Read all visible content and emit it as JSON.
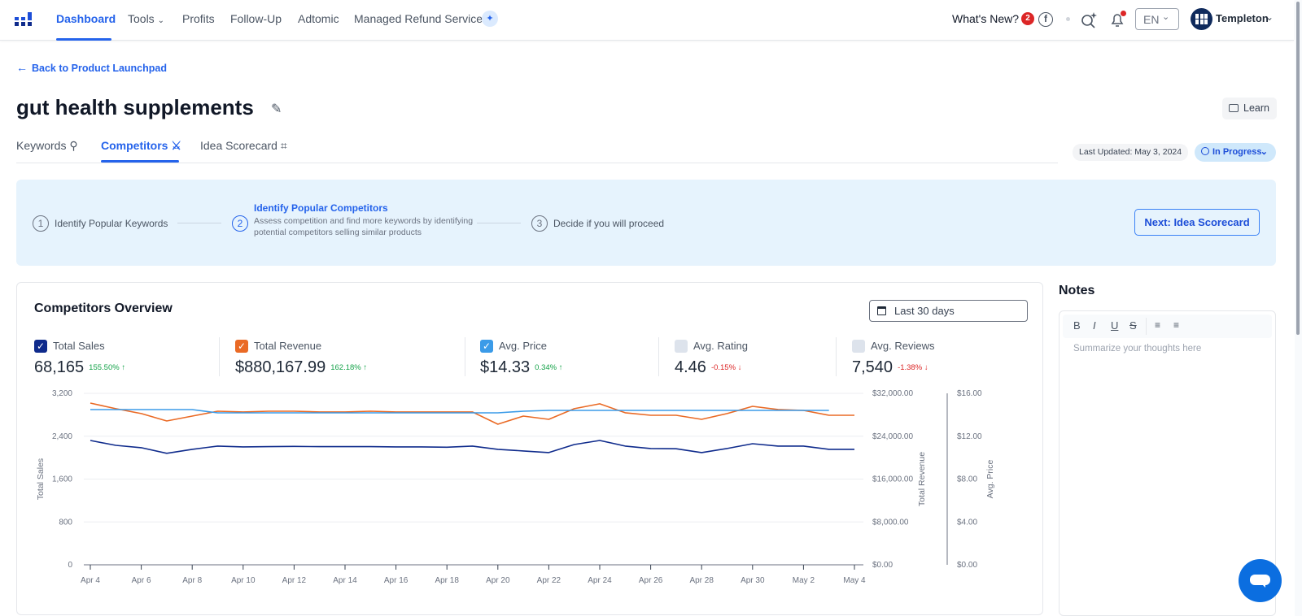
{
  "nav": {
    "items": [
      {
        "label": "Dashboard",
        "active": true
      },
      {
        "label": "Tools",
        "has_dropdown": true
      },
      {
        "label": "Profits"
      },
      {
        "label": "Follow-Up"
      },
      {
        "label": "Adtomic"
      },
      {
        "label": "Managed Refund Service"
      }
    ],
    "whats_new_label": "What's New?",
    "whats_new_count": "2",
    "language": "EN",
    "username": "Templeton",
    "icons": [
      "logo-icon",
      "sparkle-icon",
      "facebook-icon",
      "ai-search-icon",
      "bell-icon",
      "chevron-down-icon"
    ]
  },
  "back_link": "Back to Product Launchpad",
  "page_title": "gut health supplements",
  "learn_label": "Learn",
  "tabs": [
    {
      "label": "Keywords",
      "icon": "key-icon"
    },
    {
      "label": "Competitors",
      "icon": "swords-icon",
      "active": true
    },
    {
      "label": "Idea Scorecard",
      "icon": "calculator-icon"
    }
  ],
  "last_updated": "Last Updated: May 3, 2024",
  "status": "In Progress",
  "steps": [
    {
      "number": "1",
      "label": "Identify Popular Keywords"
    },
    {
      "number": "2",
      "label": "Identify Popular Competitors",
      "description": "Assess competition and find more keywords by identifying potential competitors selling similar products",
      "active": true
    },
    {
      "number": "3",
      "label": "Decide if you will proceed"
    }
  ],
  "next_button": "Next: Idea Scorecard",
  "overview": {
    "title": "Competitors Overview",
    "date_range": "Last 30 days",
    "metrics": [
      {
        "label": "Total Sales",
        "value": "68,165",
        "change": "155.50%",
        "direction": "up",
        "checked": true,
        "color": "#0f2b8c"
      },
      {
        "label": "Total Revenue",
        "value": "$880,167.99",
        "change": "162.18%",
        "direction": "up",
        "checked": true,
        "color": "#ea6a25"
      },
      {
        "label": "Avg. Price",
        "value": "$14.33",
        "change": "0.34%",
        "direction": "up",
        "checked": true,
        "color": "#3b9be8"
      },
      {
        "label": "Avg. Rating",
        "value": "4.46",
        "change": "-0.15%",
        "direction": "down",
        "checked": false
      },
      {
        "label": "Avg. Reviews",
        "value": "7,540",
        "change": "-1.38%",
        "direction": "down",
        "checked": false
      }
    ]
  },
  "notes": {
    "title": "Notes",
    "placeholder": "Summarize your thoughts here",
    "toolbar": [
      "B",
      "I",
      "U",
      "S",
      "ordered-list",
      "bullet-list"
    ]
  },
  "chart_data": {
    "type": "line",
    "title": "",
    "x": [
      "Apr 4",
      "Apr 5",
      "Apr 6",
      "Apr 7",
      "Apr 8",
      "Apr 9",
      "Apr 10",
      "Apr 11",
      "Apr 12",
      "Apr 13",
      "Apr 14",
      "Apr 15",
      "Apr 16",
      "Apr 17",
      "Apr 18",
      "Apr 19",
      "Apr 20",
      "Apr 21",
      "Apr 22",
      "Apr 23",
      "Apr 24",
      "Apr 25",
      "Apr 26",
      "Apr 27",
      "Apr 28",
      "Apr 29",
      "Apr 30",
      "May 1",
      "May 2",
      "May 3",
      "May 4"
    ],
    "x_tick_labels": [
      "Apr 4",
      "Apr 6",
      "Apr 8",
      "Apr 10",
      "Apr 12",
      "Apr 14",
      "Apr 16",
      "Apr 18",
      "Apr 20",
      "Apr 22",
      "Apr 24",
      "Apr 26",
      "Apr 28",
      "Apr 30",
      "May 2",
      "May 4"
    ],
    "series": [
      {
        "name": "Total Sales",
        "axis": "left",
        "color": "#0f2b8c",
        "values": [
          2320,
          2230,
          2185,
          2080,
          2155,
          2215,
          2200,
          2205,
          2210,
          2205,
          2205,
          2205,
          2200,
          2200,
          2195,
          2215,
          2155,
          2125,
          2095,
          2245,
          2320,
          2215,
          2170,
          2165,
          2095,
          2170,
          2260,
          2215,
          2215,
          2155,
          2155
        ]
      },
      {
        "name": "Total Revenue",
        "axis": "right1",
        "color": "#ea6a25",
        "values": [
          30180,
          29130,
          28220,
          26850,
          27760,
          28670,
          28520,
          28670,
          28670,
          28520,
          28520,
          28670,
          28520,
          28520,
          28520,
          28520,
          26240,
          27760,
          27150,
          29130,
          30040,
          28370,
          27910,
          27910,
          27150,
          28220,
          29580,
          28980,
          28820,
          27910,
          27910
        ]
      },
      {
        "name": "Avg. Price",
        "axis": "right2",
        "color": "#3b9be8",
        "values": [
          14.48,
          14.48,
          14.48,
          14.48,
          14.48,
          14.18,
          14.18,
          14.18,
          14.18,
          14.18,
          14.18,
          14.18,
          14.18,
          14.18,
          14.18,
          14.18,
          14.18,
          14.33,
          14.41,
          14.41,
          14.41,
          14.41,
          14.41,
          14.41,
          14.41,
          14.41,
          14.41,
          14.41,
          14.41,
          14.41,
          null
        ]
      }
    ],
    "axes": {
      "left": {
        "label": "Total Sales",
        "range": [
          0,
          3200
        ],
        "ticks": [
          "0",
          "800",
          "1,600",
          "2,400",
          "3,200"
        ]
      },
      "right1": {
        "label": "Total Revenue",
        "range": [
          0,
          32000
        ],
        "ticks": [
          "$0.00",
          "$8,000.00",
          "$16,000.00",
          "$24,000.00",
          "$32,000.00"
        ]
      },
      "right2": {
        "label": "Avg. Price",
        "range": [
          0,
          16
        ],
        "ticks": [
          "$0.00",
          "$4.00",
          "$8.00",
          "$12.00",
          "$16.00"
        ]
      }
    },
    "grid": true,
    "legend": "none"
  }
}
